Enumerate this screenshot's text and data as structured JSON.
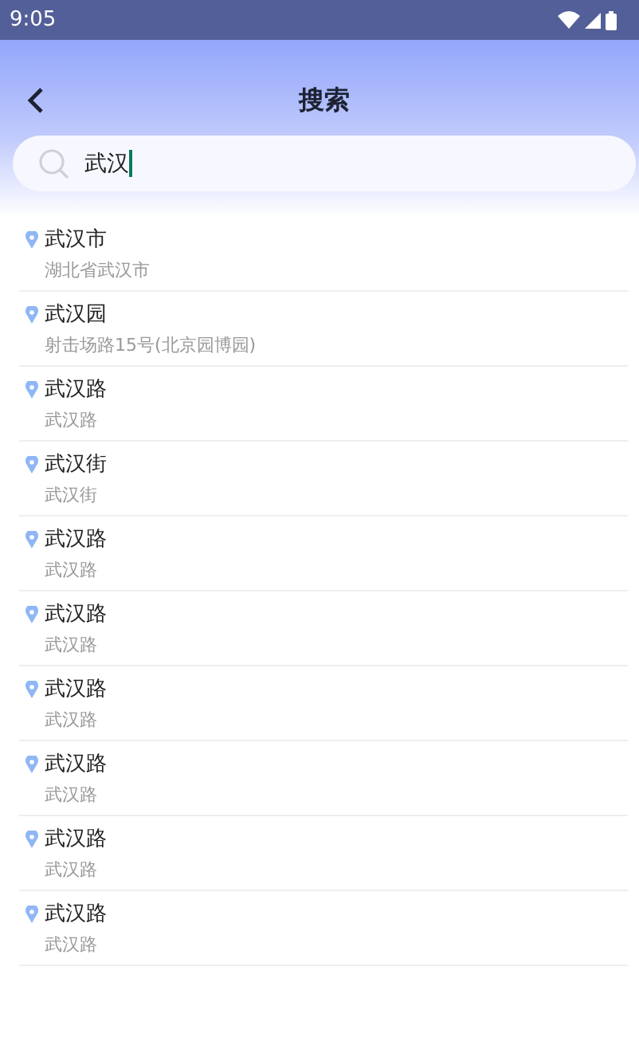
{
  "status_bar": {
    "time": "9:05"
  },
  "header": {
    "title": "搜索"
  },
  "search": {
    "value": "武汉"
  },
  "results": [
    {
      "name": "武汉市",
      "address": "湖北省武汉市"
    },
    {
      "name": "武汉园",
      "address": "射击场路15号(北京园博园)"
    },
    {
      "name": "武汉路",
      "address": "武汉路"
    },
    {
      "name": "武汉街",
      "address": "武汉街"
    },
    {
      "name": "武汉路",
      "address": "武汉路"
    },
    {
      "name": "武汉路",
      "address": "武汉路"
    },
    {
      "name": "武汉路",
      "address": "武汉路"
    },
    {
      "name": "武汉路",
      "address": "武汉路"
    },
    {
      "name": "武汉路",
      "address": "武汉路"
    },
    {
      "name": "武汉路",
      "address": "武汉路"
    }
  ]
}
